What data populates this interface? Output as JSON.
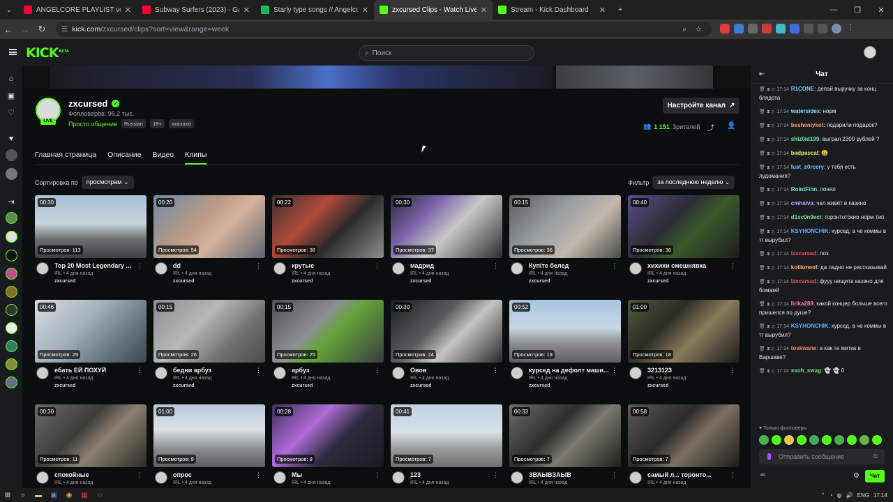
{
  "browser": {
    "tabs": [
      {
        "title": "ANGELCORE PLAYLIST vol. 1",
        "color": "#ff0033"
      },
      {
        "title": "Subway Surfers (2023) - Gameplay",
        "color": "#ff0033"
      },
      {
        "title": "Starly type songs // AngelcoreMix",
        "color": "#1db954"
      },
      {
        "title": "zxcursed Clips - Watch Live on Kick",
        "color": "#53fc18"
      },
      {
        "title": "Stream - Kick Dashboard",
        "color": "#53fc18"
      }
    ],
    "url_domain": "kick.com",
    "url_path": "/zxcursed/clips?sort=view&range=week"
  },
  "header": {
    "logo": "KICK",
    "logo_sup": "BETA",
    "search_placeholder": "Поиск"
  },
  "channel": {
    "name": "zxcursed",
    "live_badge": "LIVE",
    "followers": "Фолловеров: 96,2 тыс.",
    "category": "Просто общение",
    "tags": [
      "Russian",
      "18+",
      "ахахаха"
    ],
    "settings_button": "Настройте канал",
    "viewers_count": "1 151",
    "viewers_label": "Зрителей",
    "nav": [
      "Главная страница",
      "Описание",
      "Видео",
      "Клипы"
    ],
    "nav_selected": 3
  },
  "controls": {
    "sort_label": "Сортировка по",
    "sort_value": "просмотрам",
    "filter_label": "Фильтр",
    "filter_value": "за последнюю неделю"
  },
  "clips": [
    {
      "duration": "00:30",
      "views": "Просмотров: 113",
      "title": "Top 20 Most Legendary ...",
      "meta": "IRL • 4 дня назад",
      "channel": "zxcursed",
      "bg": "linear-gradient(180deg,#a9c0d8 0%,#c8d4dc 45%,#6b6f70 70%,#3e4044 100%)"
    },
    {
      "duration": "00:20",
      "views": "Просмотров: 54",
      "title": "dd",
      "meta": "IRL • 4 дня назад",
      "channel": "zxcursed",
      "bg": "linear-gradient(135deg,#6e8aa8 0%,#b89a84 40%,#d6b39c 60%,#5c6570 100%)"
    },
    {
      "duration": "00:22",
      "views": "Просмотров: 38",
      "title": "крутые",
      "meta": "IRL • 4 дня назад",
      "channel": "zxcursed",
      "bg": "linear-gradient(135deg,#3b2f2c 0%,#b04a3c 35%,#2a2a2a 60%,#8a8f8c 100%)"
    },
    {
      "duration": "00:30",
      "views": "Просмотров: 37",
      "title": "мадрид",
      "meta": "IRL • 4 дня назад",
      "channel": "zxcursed",
      "bg": "linear-gradient(135deg,#2a2a35 0%,#7a62a8 30%,#c8c8c8 55%,#2e2e30 100%)"
    },
    {
      "duration": "00:15",
      "views": "Просмотров: 36",
      "title": "Купіте белед",
      "meta": "IRL • 4 дня назад",
      "channel": "zxcursed",
      "bg": "linear-gradient(135deg,#5a5a5a 0%,#9aa0a4 40%,#c4b8ac 65%,#4a4a4a 100%)"
    },
    {
      "duration": "00:40",
      "views": "Просмотров: 36",
      "title": "хихихи смешнявка",
      "meta": "IRL • 4 дня назад",
      "channel": "zxcursed",
      "bg": "linear-gradient(135deg,#5a4c8a 0%,#2c2c34 40%,#3a5a2a 60%,#1c1c20 100%)"
    },
    {
      "duration": "00:46",
      "views": "Просмотров: 29",
      "title": "ебать ЕЙ ПОХУЙ",
      "meta": "IRL • 4 дня назад",
      "channel": "zxcursed",
      "bg": "linear-gradient(135deg,#d8dde2 0%,#a7b2bc 40%,#6b7a88 70%,#3b4650 100%)"
    },
    {
      "duration": "00:15",
      "views": "Просмотров: 26",
      "title": "бедни арбуз",
      "meta": "IRL • 4 дня назад",
      "channel": "zxcursed",
      "bg": "linear-gradient(135deg,#8a8e90 0%,#b6b8b6 40%,#6e7270 70%,#4a4c4c 100%)"
    },
    {
      "duration": "00:15",
      "views": "Просмотров: 25",
      "title": "арбуз",
      "meta": "IRL • 4 дня назад",
      "channel": "zxcursed",
      "bg": "linear-gradient(135deg,#4e5254 0%,#8c9092 40%,#62a33a 55%,#3a3c3e 100%)"
    },
    {
      "duration": "00:30",
      "views": "Просмотров: 24",
      "title": "Овов",
      "meta": "IRL • 4 дня назад",
      "channel": "zxcursed",
      "bg": "linear-gradient(135deg,#1c1c20 0%,#5c5c60 40%,#c4c4c0 60%,#2a2a2e 100%)"
    },
    {
      "duration": "00:52",
      "views": "Просмотров: 19",
      "title": "курсед на дефолт маши...",
      "meta": "IRL • 4 дня назад",
      "channel": "zxcursed",
      "bg": "linear-gradient(180deg,#a8c4e0 0%,#c8d8e4 45%,#8a8e90 70%,#5c6064 100%)"
    },
    {
      "duration": "01:00",
      "views": "Просмотров: 18",
      "title": "3213123",
      "meta": "IRL • 4 дня назад",
      "channel": "zxcursed",
      "bg": "linear-gradient(135deg,#4e5a3c 0%,#2a2c24 35%,#8a7a5c 60%,#1c1c1c 100%)"
    },
    {
      "duration": "00:30",
      "views": "Просмотров: 11",
      "title": "спокойные",
      "meta": "IRL • 4 дня назад",
      "channel": "zxcursed",
      "bg": "linear-gradient(135deg,#6c6c68 0%,#3c3c3a 40%,#8a8070 60%,#2a2a28 100%)"
    },
    {
      "duration": "01:00",
      "views": "Просмотров: 9",
      "title": "опрос",
      "meta": "IRL • 4 дня назад",
      "channel": "zxcursed",
      "bg": "linear-gradient(180deg,#b8c8d8 0%,#dce2e6 40%,#8a8e90 70%,#5a5e60 100%)"
    },
    {
      "duration": "00:28",
      "views": "Просмотров: 9",
      "title": "Мы",
      "meta": "IRL • 4 дня назад",
      "channel": "zxcursed",
      "bg": "linear-gradient(135deg,#3c2c5c 0%,#b06cd8 35%,#2c2c3c 60%,#1a1a22 100%)"
    },
    {
      "duration": "00:41",
      "views": "Просмотров: 7",
      "title": "123",
      "meta": "IRL • 4 дня назад",
      "channel": "zxcursed",
      "bg": "linear-gradient(180deg,#c0d2e2 0%,#d8e0e4 45%,#9a9c9c 70%,#6e7072 100%)"
    },
    {
      "duration": "00:33",
      "views": "Просмотров: 7",
      "title": "ЗВАЫВЗАЫВ",
      "meta": "IRL • 4 дня назад",
      "channel": "zxcursed",
      "bg": "linear-gradient(135deg,#6c6e68 0%,#2c2e2a 40%,#7a7a70 60%,#1c1e1a 100%)"
    },
    {
      "duration": "00:58",
      "views": "Просмотров: 7",
      "title": "самый л... торонто...",
      "meta": "IRL • 4 дня назад",
      "channel": "zxcursed",
      "bg": "linear-gradient(135deg,#5c5a54 0%,#2a2a28 40%,#7c7064 60%,#1a1a18 100%)"
    }
  ],
  "chat": {
    "title": "Чат",
    "messages": [
      {
        "time": "17:14",
        "user": "R1CONE",
        "color": "#6fc8ff",
        "text": "депай выручку за конц блядота"
      },
      {
        "time": "17:14",
        "user": "watersidex",
        "color": "#7fdcff",
        "text": "норм"
      },
      {
        "time": "17:14",
        "user": "besheniykot",
        "color": "#ff9a6a",
        "text": "подарили подарок?"
      },
      {
        "time": "17:14",
        "user": "shiz0id199",
        "color": "#6fe6a0",
        "text": "выграл 2300 рублей ?"
      },
      {
        "time": "17:14",
        "user": "badpascal",
        "color": "#e6e66f",
        "text": "😀"
      },
      {
        "time": "17:14",
        "user": "lust_s0rcery",
        "color": "#6fc8ff",
        "text": "у тебя есть лудомания?"
      },
      {
        "time": "17:14",
        "user": "RointFinn",
        "color": "#6fe6c8",
        "text": "понял"
      },
      {
        "time": "17:14",
        "user": "cmhalva",
        "color": "#c89cff",
        "text": "чел живёт в казино"
      },
      {
        "time": "17:14",
        "user": "d1sc0n9ect",
        "color": "#6fe68a",
        "text": "торонтотокио норм тип"
      },
      {
        "time": "17:14",
        "user": "KSYHONCHIK",
        "color": "#5ab0ff",
        "text": "курсед, а че коммы в тг вырубил?"
      },
      {
        "time": "17:14",
        "user": "lzxcvrssd",
        "color": "#ff4a4a",
        "text": "лох"
      },
      {
        "time": "17:14",
        "user": "kotikmeof",
        "color": "#ffb06f",
        "text": "да ладно не рассказывай"
      },
      {
        "time": "17:14",
        "user": "lzxcvrssd",
        "color": "#ff4a4a",
        "text": "фууу нищита казино для бомжей"
      },
      {
        "time": "17:14",
        "user": "lirika288",
        "color": "#ff7ab8",
        "text": "какой концер больше всего пришелся по душе?"
      },
      {
        "time": "17:14",
        "user": "KSYHONCHIK",
        "color": "#5ab0ff",
        "text": "курсед, а че коммы в тг вырубил?"
      },
      {
        "time": "17:14",
        "user": "toskwane",
        "color": "#ff8a6f",
        "text": "а как те митка в Варшаве?"
      },
      {
        "time": "17:14",
        "user": "ssoh_swag",
        "color": "#6fe68a",
        "text": "👻 👻 0"
      }
    ],
    "followers_only": "Только фолловеры",
    "send_placeholder": "Отправить сообщение",
    "send_button": "Чат"
  },
  "taskbar": {
    "lang": "ENG",
    "time": "17:14"
  }
}
